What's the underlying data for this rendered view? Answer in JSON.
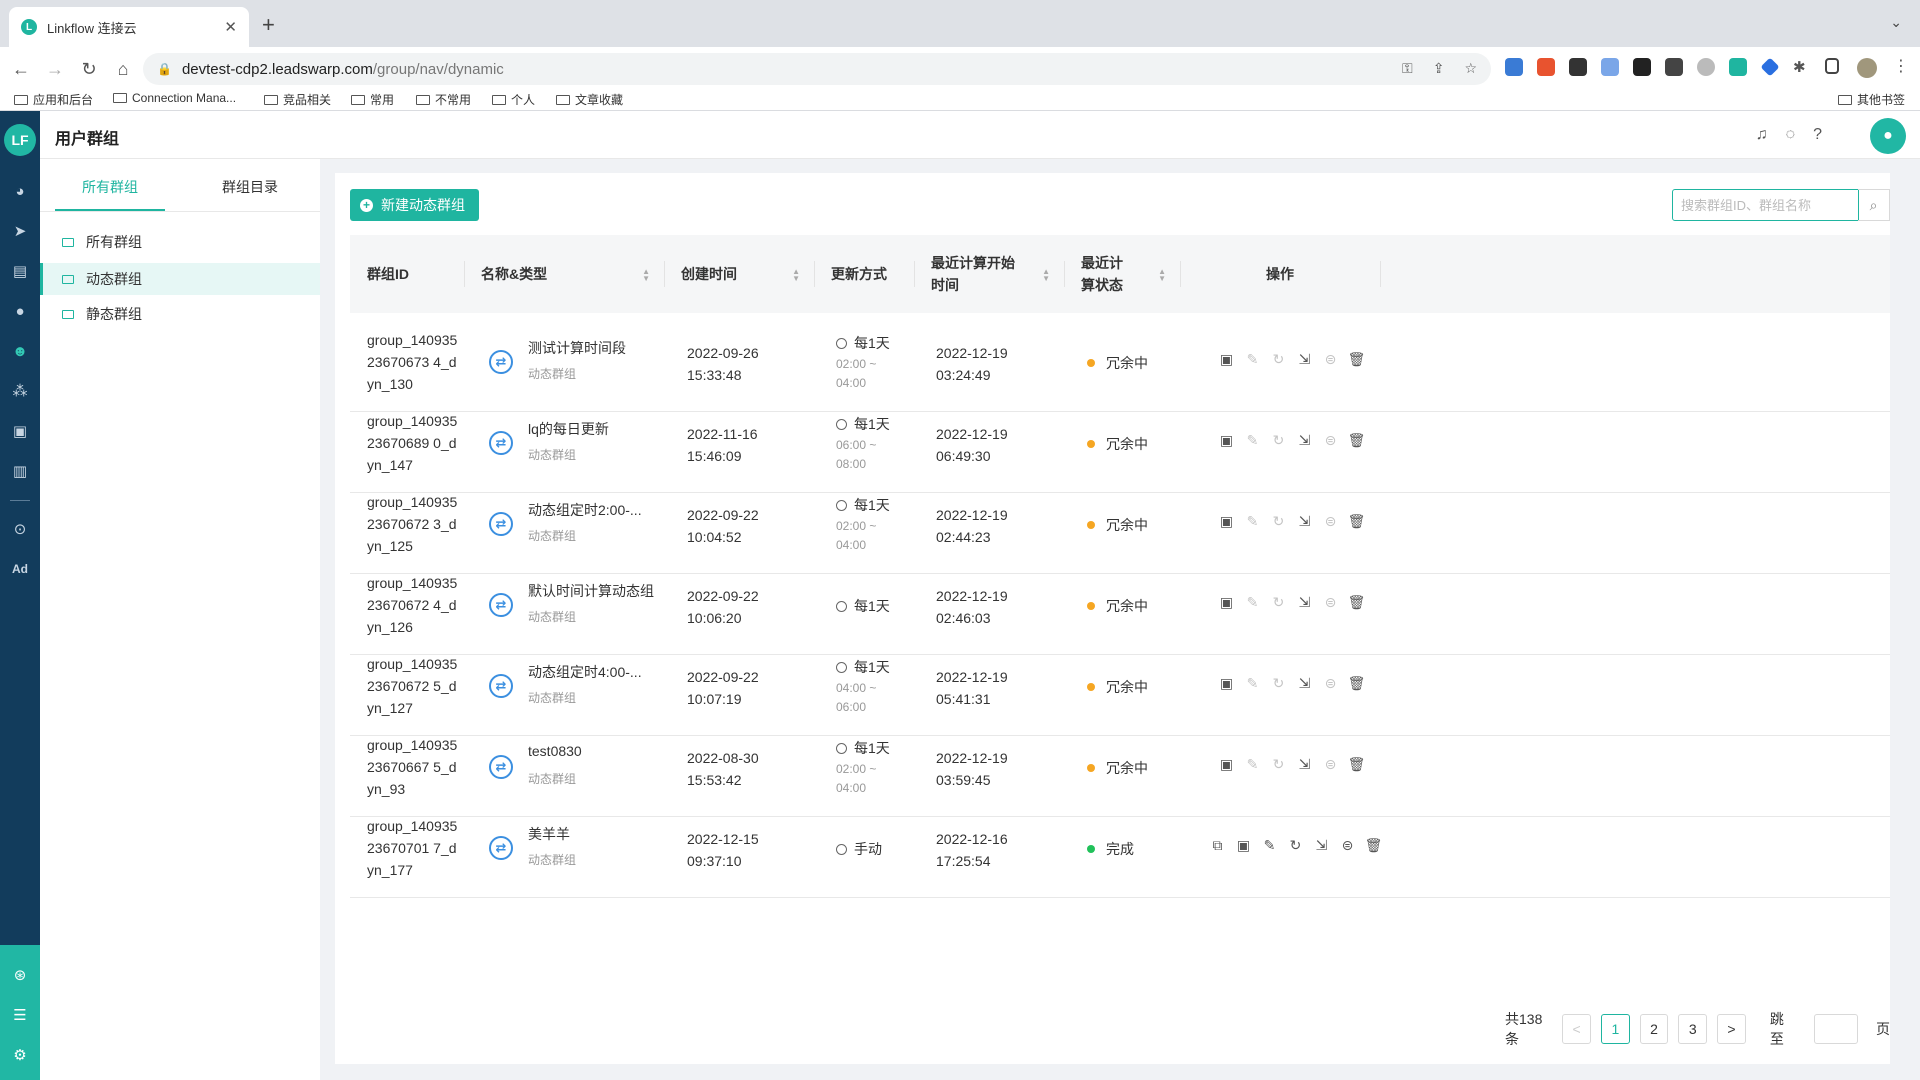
{
  "browser": {
    "tab_title": "Linkflow 连接云",
    "url_host": "devtest-cdp2.leadswarp.com",
    "url_path": "/group/nav/dynamic",
    "bookmarks": [
      "应用和后台",
      "Connection Mana...",
      "竞品相关",
      "常用",
      "不常用",
      "个人",
      "文章收藏"
    ],
    "other_bookmarks": "其他书签"
  },
  "app": {
    "logo_text": "LF",
    "page_title": "用户群组",
    "nav_icons": [
      "dashboard-icon",
      "send-icon",
      "layout-icon",
      "user-icon",
      "group-icon",
      "cluster-icon",
      "bookmark-icon",
      "chart-icon",
      "wechat-icon",
      "ad-icon"
    ],
    "ad_label": "Ad",
    "accent": "#1fb5a0"
  },
  "sidebar": {
    "tabs": [
      "所有群组",
      "群组目录"
    ],
    "active_tab": 0,
    "items": [
      "所有群组",
      "动态群组",
      "静态群组"
    ],
    "active_item": 1
  },
  "toolbar": {
    "new_button": "新建动态群组",
    "search_placeholder": "搜索群组ID、群组名称"
  },
  "table": {
    "headers": [
      "群组ID",
      "名称&类型",
      "创建时间",
      "更新方式",
      "最近计算开始时间",
      "最近计算状态",
      "操作"
    ],
    "rows": [
      {
        "id": "group_14093523670673 4_dyn_130",
        "name": "测试计算时间段",
        "type": "动态群组",
        "created_date": "2022-09-26",
        "created_time": "15:33:48",
        "freq": "每1天",
        "range_start": "02:00 ~",
        "range_end": "04:00",
        "calc_date": "2022-12-19",
        "calc_time": "03:24:49",
        "status": "冗余中",
        "status_color": "#f5a623",
        "extra_action": false
      },
      {
        "id": "group_14093523670689 0_dyn_147",
        "name": "lq的每日更新",
        "type": "动态群组",
        "created_date": "2022-11-16",
        "created_time": "15:46:09",
        "freq": "每1天",
        "range_start": "06:00 ~",
        "range_end": "08:00",
        "calc_date": "2022-12-19",
        "calc_time": "06:49:30",
        "status": "冗余中",
        "status_color": "#f5a623",
        "extra_action": false
      },
      {
        "id": "group_14093523670672 3_dyn_125",
        "name": "动态组定时2:00-...",
        "type": "动态群组",
        "created_date": "2022-09-22",
        "created_time": "10:04:52",
        "freq": "每1天",
        "range_start": "02:00 ~",
        "range_end": "04:00",
        "calc_date": "2022-12-19",
        "calc_time": "02:44:23",
        "status": "冗余中",
        "status_color": "#f5a623",
        "extra_action": false
      },
      {
        "id": "group_14093523670672 4_dyn_126",
        "name": "默认时间计算动态组",
        "type": "动态群组",
        "created_date": "2022-09-22",
        "created_time": "10:06:20",
        "freq": "每1天",
        "range_start": "",
        "range_end": "",
        "calc_date": "2022-12-19",
        "calc_time": "02:46:03",
        "status": "冗余中",
        "status_color": "#f5a623",
        "extra_action": false
      },
      {
        "id": "group_14093523670672 5_dyn_127",
        "name": "动态组定时4:00-...",
        "type": "动态群组",
        "created_date": "2022-09-22",
        "created_time": "10:07:19",
        "freq": "每1天",
        "range_start": "04:00 ~",
        "range_end": "06:00",
        "calc_date": "2022-12-19",
        "calc_time": "05:41:31",
        "status": "冗余中",
        "status_color": "#f5a623",
        "extra_action": false
      },
      {
        "id": "group_14093523670667 5_dyn_93",
        "name": "test0830",
        "type": "动态群组",
        "created_date": "2022-08-30",
        "created_time": "15:53:42",
        "freq": "每1天",
        "range_start": "02:00 ~",
        "range_end": "04:00",
        "calc_date": "2022-12-19",
        "calc_time": "03:59:45",
        "status": "冗余中",
        "status_color": "#f5a623",
        "extra_action": false
      },
      {
        "id": "group_14093523670701 7_dyn_177",
        "name": "美羊羊",
        "type": "动态群组",
        "created_date": "2022-12-15",
        "created_time": "09:37:10",
        "freq": "手动",
        "range_start": "",
        "range_end": "",
        "calc_date": "2022-12-16",
        "calc_time": "17:25:54",
        "status": "完成",
        "status_color": "#21c15a",
        "extra_action": true
      }
    ]
  },
  "pagination": {
    "total": "共138条",
    "pages": [
      "1",
      "2",
      "3"
    ],
    "current": "1",
    "prev": "<",
    "next": ">",
    "jump_label": "跳至",
    "page_suffix": "页"
  }
}
